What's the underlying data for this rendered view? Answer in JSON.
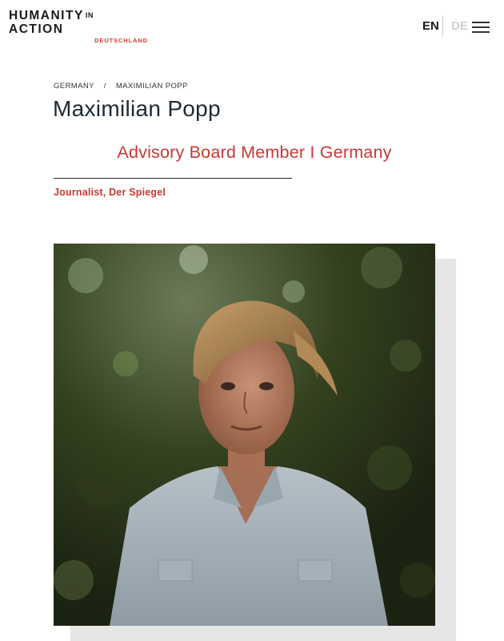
{
  "header": {
    "logo": {
      "line1": "HUMANITY",
      "line1_small": "IN",
      "line2": "ACTION",
      "sub": "DEUTSCHLAND"
    },
    "lang_en": "EN",
    "lang_de": "DE",
    "menu_icon": "hamburger-menu-icon"
  },
  "breadcrumb": {
    "items": [
      "GERMANY",
      "MAXIMILIAN POPP"
    ],
    "separator": "/"
  },
  "profile": {
    "name": "Maximilian Popp",
    "role": "Advisory Board Member I Germany",
    "subtitle": "Journalist, Der Spiegel"
  },
  "colors": {
    "accent_red": "#c93833",
    "text_dark": "#1f2933",
    "inactive_lang": "#d0d0d0"
  }
}
